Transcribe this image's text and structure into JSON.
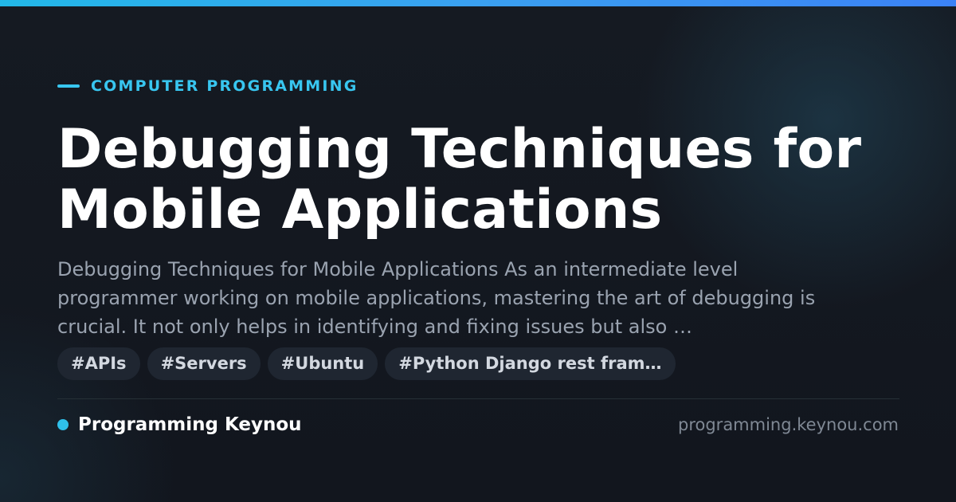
{
  "kicker": "COMPUTER PROGRAMMING",
  "title": "Debugging Techniques for Mobile Applications",
  "summary": "Debugging Techniques for Mobile Applications As an intermediate level programmer working on mobile applications, mastering the art of debugging is crucial. It not only helps in identifying and fixing issues but also …",
  "tags": [
    "#APIs",
    "#Servers",
    "#Ubuntu",
    "#Python Django rest fram…"
  ],
  "footer": {
    "brand": "Programming Keynou",
    "url": "programming.keynou.com"
  },
  "colors": {
    "accent": "#38c6f0",
    "background": "#12161e",
    "tag_background": "#1f2631"
  }
}
